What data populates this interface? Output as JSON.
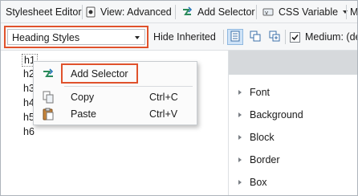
{
  "toolbar": {
    "title": "Stylesheet Editor",
    "view_label": "View: Advanced",
    "add_selector_label": "Add Selector",
    "css_variable_label": "CSS Variable",
    "more_label": "M"
  },
  "options": {
    "style_group_value": "Heading Styles",
    "hide_inherited_label": "Hide Inherited",
    "medium_label": "Medium: (de",
    "medium_checked": true
  },
  "selectors": [
    "h1",
    "h2",
    "h3",
    "h4",
    "h5",
    "h6"
  ],
  "selected_selector": "h1",
  "properties": [
    "Font",
    "Background",
    "Block",
    "Border",
    "Box"
  ],
  "context_menu": {
    "items": [
      {
        "label": "Add Selector",
        "shortcut": "",
        "icon": "add-selector-icon"
      },
      {
        "label": "Copy",
        "shortcut": "Ctrl+C",
        "icon": "copy-icon"
      },
      {
        "label": "Paste",
        "shortcut": "Ctrl+V",
        "icon": "paste-icon"
      }
    ]
  },
  "colors": {
    "highlight_border": "#e0522c",
    "toolbar_bg": "#f6f7f8",
    "panel_header": "#d6d9dc"
  }
}
